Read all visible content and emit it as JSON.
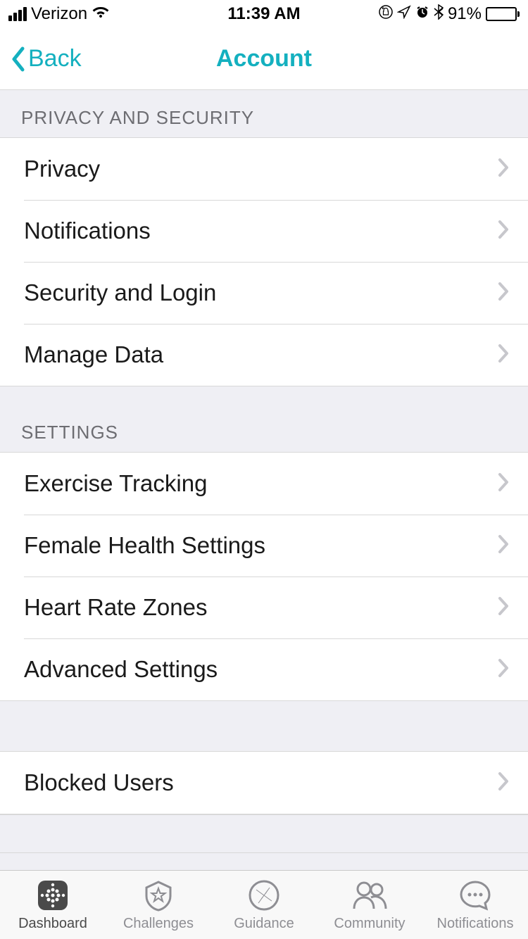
{
  "status": {
    "carrier": "Verizon",
    "time": "11:39 AM",
    "battery": "91%"
  },
  "nav": {
    "back": "Back",
    "title": "Account"
  },
  "sections": [
    {
      "header": "PRIVACY AND SECURITY",
      "items": [
        "Privacy",
        "Notifications",
        "Security and Login",
        "Manage Data"
      ]
    },
    {
      "header": "SETTINGS",
      "items": [
        "Exercise Tracking",
        "Female Health Settings",
        "Heart Rate Zones",
        "Advanced Settings"
      ]
    },
    {
      "header": "",
      "items": [
        "Blocked Users"
      ]
    }
  ],
  "tabs": [
    {
      "label": "Dashboard"
    },
    {
      "label": "Challenges"
    },
    {
      "label": "Guidance"
    },
    {
      "label": "Community"
    },
    {
      "label": "Notifications"
    }
  ]
}
